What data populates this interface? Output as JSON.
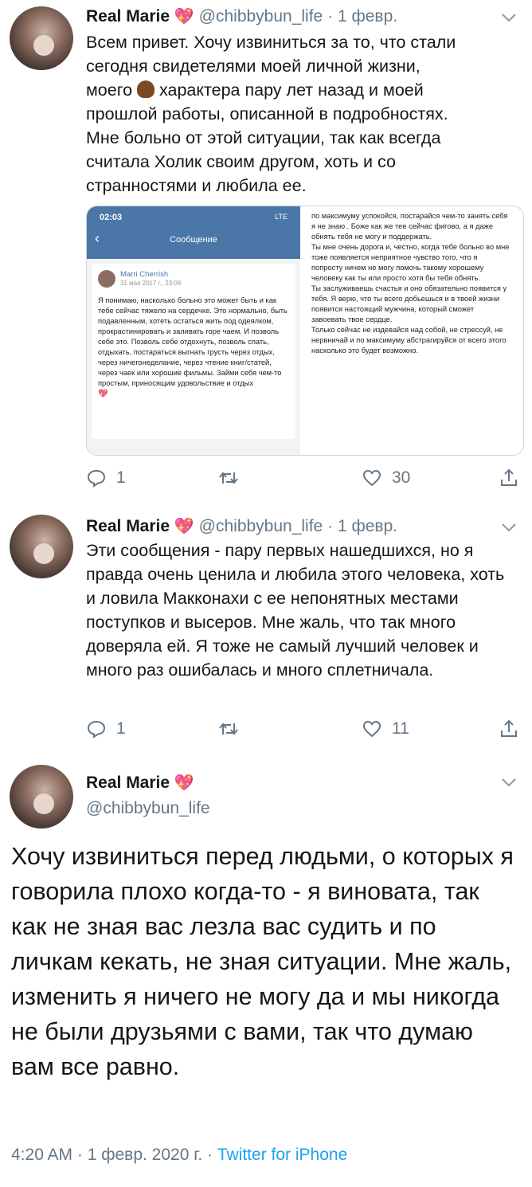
{
  "tweet1": {
    "name": "Real Marie",
    "handle": "@chibbybun_life",
    "date": "1 февр.",
    "text_lines": [
      "Всем привет. Хочу извиниться за то, что стали",
      "сегодня свидетелями моей личной жизни,",
      "моего",
      "характера пару лет назад и моей",
      "прошлой работы, описанной в подробностях.",
      "Мне больно от этой ситуации, так как всегда",
      "считала Холик своим другом, хоть и со",
      "странностями и любила ее."
    ],
    "media": {
      "time": "02:03",
      "status": "LTE",
      "title": "Сообщение",
      "author": "Marri Cherrish",
      "msg_date": "31 мая 2017 г., 23:06",
      "left_text": "Я понимаю, насколько больно это может быть и как тебе сейчас тяжело на сердечке. Это нормально, быть подавленным, хотеть остаться жить под одеялком, прокрастинировать и заливать горе чаем. И позволь себе это. Позволь себе отдохнуть, позволь спать, отдыхать, постараться выгнать грусть через отдых, через ничегонеделание, через чтение книг/статей, через чаек или хорошие фильмы. Займи себя чем-то простым, приносящим удовольствие и отдых",
      "right_text": "по максимуму успокойся, постарайся чем-то занять себя я не знаю.. Боже как же тее сейчас фигово, а я даже обнять тебя не могу и поддержать.\nТы мне очень дорога и, честно, когда тебе больно во мне тоже появляется неприятное чувство того, что я попросту ничем не могу помочь такому хорошему человеку как ты или просто хотя бы тебя обнять.\nТы заслуживаешь счастья и оно обязательно появится у тебя. Я верю, что ты всего добьешься и в твоей жизни появится настоящий мужчина, который сможет завоевать твое сердце.\nТолько сейчас не издевайся над собой, не стрессуй, не нервничай и по максимуму абстрагируйся от всего этого насколько это будет возможно."
    },
    "replies": "1",
    "likes": "30"
  },
  "tweet2": {
    "name": "Real Marie",
    "handle": "@chibbybun_life",
    "date": "1 февр.",
    "text": "Эти сообщения - пару первых нашедшихся, но я правда очень ценила и любила этого человека, хоть и ловила Макконахи с ее непонятных местами поступков и высеров. Мне жаль, что так много доверяла ей. Я тоже не самый лучший человек и много раз ошибалась и много сплетничала.",
    "replies": "1",
    "likes": "11"
  },
  "tweet3": {
    "name": "Real Marie",
    "handle": "@chibbybun_life",
    "text": "Хочу извиниться перед людьми, о которых я говорила плохо когда-то - я виновата, так как не зная вас лезла вас судить и по личкам кекать, не зная ситуации. Мне жаль, изменить я ничего не могу да и мы никогда не были друзьями с вами, так что думаю вам все равно.",
    "timestamp": "4:20 AM · 1 февр. 2020 г. · ",
    "source": "Twitter for iPhone"
  },
  "icons": [
    "reply-icon",
    "retweet-icon",
    "like-icon",
    "share-icon",
    "chevron-down-icon",
    "sparkling-heart-icon",
    "poop-emoji-icon"
  ],
  "colors": {
    "accent": "#1da1f2",
    "gray": "#657786",
    "heart": "#e0245e",
    "vk_blue": "#4a76a8"
  }
}
